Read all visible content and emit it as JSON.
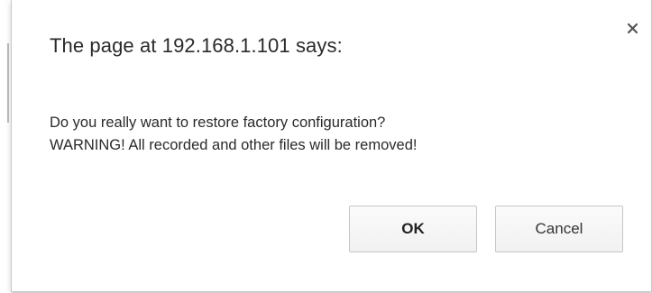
{
  "dialog": {
    "title": "The page at 192.168.1.101 says:",
    "message_lines": [
      "Do you really want to restore factory configuration?",
      "WARNING! All recorded and other files will be removed!"
    ],
    "close_icon": "close-icon",
    "buttons": {
      "ok_label": "OK",
      "cancel_label": "Cancel"
    }
  },
  "colors": {
    "backdrop": "#e9e9e9",
    "dialog_bg": "#ffffff",
    "text": "#2a2a2a",
    "button_border": "#c6c6c6"
  }
}
